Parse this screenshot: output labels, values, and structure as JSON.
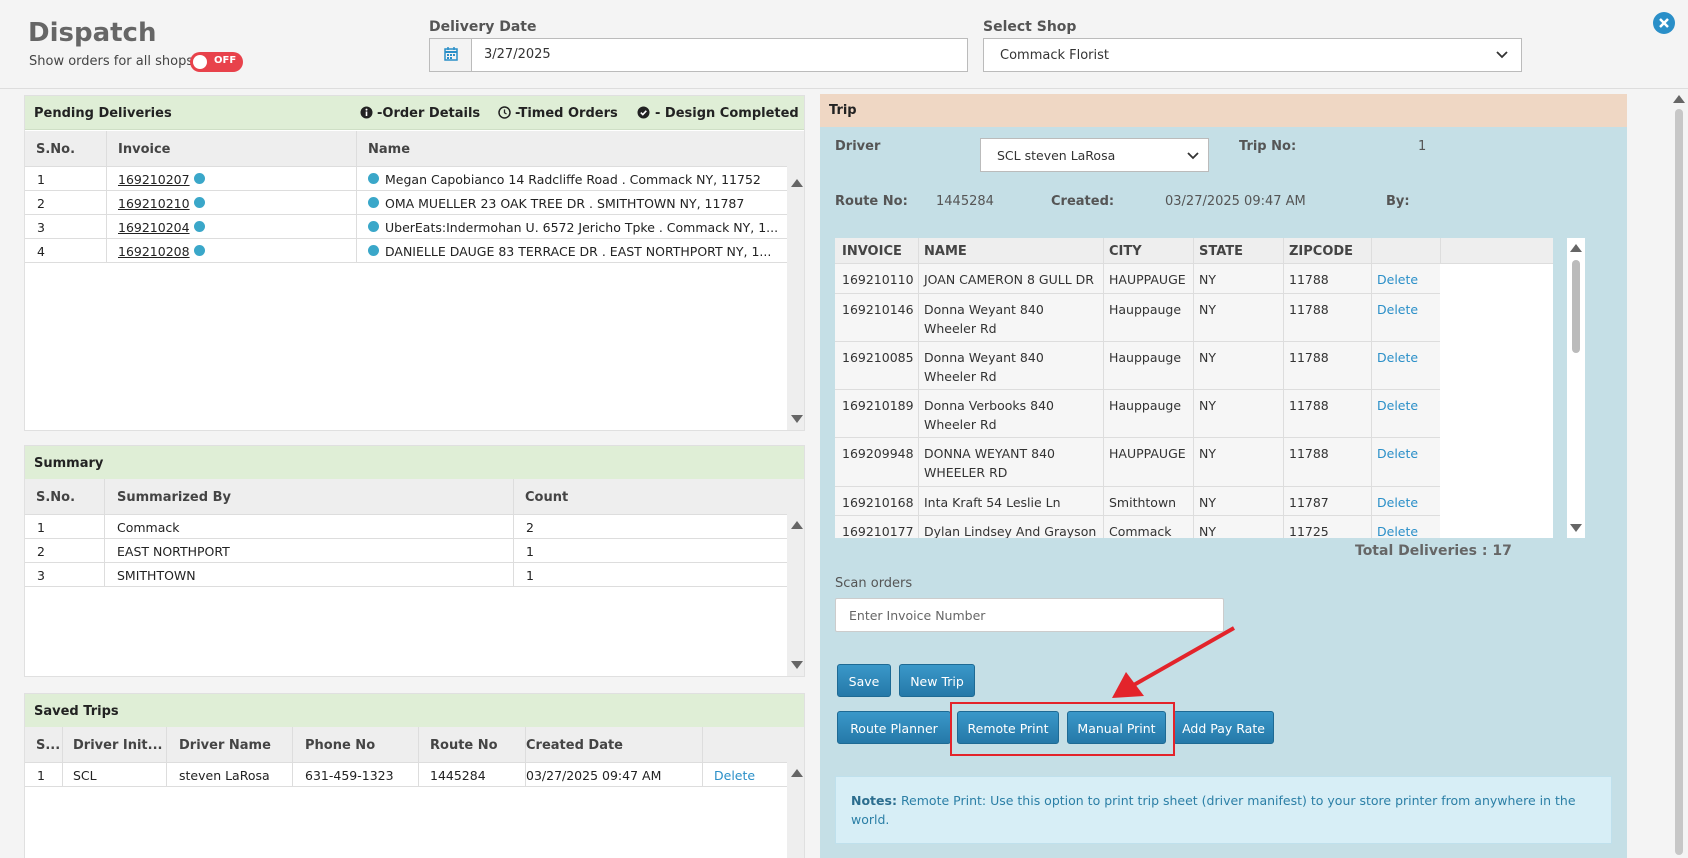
{
  "header": {
    "title": "Dispatch",
    "show_all_label": "Show orders for all shops",
    "toggle_state": "OFF",
    "delivery_date_label": "Delivery Date",
    "delivery_date_value": "3/27/2025",
    "select_shop_label": "Select Shop",
    "select_shop_value": "Commack Florist"
  },
  "pending": {
    "title": "Pending Deliveries",
    "legend_order_details": "-Order Details",
    "legend_timed_orders": "-Timed Orders",
    "legend_design_completed": "- Design Completed",
    "columns": [
      "S.No.",
      "Invoice",
      "Name"
    ],
    "rows": [
      {
        "sno": "1",
        "invoice": "169210207",
        "name": "Megan Capobianco 14 Radcliffe Road . Commack NY, 11752"
      },
      {
        "sno": "2",
        "invoice": "169210210",
        "name": "OMA MUELLER 23 OAK TREE DR . SMITHTOWN NY, 11787"
      },
      {
        "sno": "3",
        "invoice": "169210204",
        "name": "UberEats:Indermohan U. 6572 Jericho Tpke . Commack NY, 1..."
      },
      {
        "sno": "4",
        "invoice": "169210208",
        "name": "DANIELLE DAUGE 83 TERRACE DR . EAST NORTHPORT NY, 1..."
      }
    ]
  },
  "summary": {
    "title": "Summary",
    "columns": [
      "S.No.",
      "Summarized By",
      "Count"
    ],
    "rows": [
      {
        "sno": "1",
        "by": "Commack",
        "count": "2"
      },
      {
        "sno": "2",
        "by": "EAST NORTHPORT",
        "count": "1"
      },
      {
        "sno": "3",
        "by": "SMITHTOWN",
        "count": "1"
      }
    ]
  },
  "saved_trips": {
    "title": "Saved Trips",
    "columns": [
      "S...",
      "Driver Init...",
      "Driver Name",
      "Phone No",
      "Route No",
      "Created Date"
    ],
    "rows": [
      {
        "sno": "1",
        "init": "SCL",
        "driver": "steven LaRosa",
        "phone": "631-459-1323",
        "route": "1445284",
        "created": "03/27/2025 09:47 AM",
        "action": "Delete"
      }
    ]
  },
  "trip": {
    "title": "Trip",
    "driver_label": "Driver",
    "driver_value": "SCL steven LaRosa",
    "trip_no_label": "Trip No:",
    "trip_no_value": "1",
    "route_no_label": "Route No:",
    "route_no_value": "1445284",
    "created_label": "Created:",
    "created_value": "03/27/2025 09:47 AM",
    "by_label": "By:",
    "columns": [
      "INVOICE",
      "NAME",
      "CITY",
      "STATE",
      "ZIPCODE"
    ],
    "rows": [
      {
        "invoice": "169210110",
        "name": "JOAN CAMERON 8 GULL DR",
        "city": "HAUPPAUGE",
        "state": "NY",
        "zip": "11788",
        "action": "Delete"
      },
      {
        "invoice": "169210146",
        "name": "Donna Weyant 840 Wheeler Rd",
        "city": "Hauppauge",
        "state": "NY",
        "zip": "11788",
        "action": "Delete"
      },
      {
        "invoice": "169210085",
        "name": "Donna Weyant 840 Wheeler Rd",
        "city": "Hauppauge",
        "state": "NY",
        "zip": "11788",
        "action": "Delete"
      },
      {
        "invoice": "169210189",
        "name": "Donna Verbooks 840 Wheeler Rd",
        "city": "Hauppauge",
        "state": "NY",
        "zip": "11788",
        "action": "Delete"
      },
      {
        "invoice": "169209948",
        "name": "DONNA WEYANT 840 WHEELER RD",
        "city": "HAUPPAUGE",
        "state": "NY",
        "zip": "11788",
        "action": "Delete"
      },
      {
        "invoice": "169210168",
        "name": "Inta Kraft 54 Leslie Ln",
        "city": "Smithtown",
        "state": "NY",
        "zip": "11787",
        "action": "Delete"
      },
      {
        "invoice": "169210177",
        "name": "Dylan Lindsey And Grayson",
        "city": "Commack",
        "state": "NY",
        "zip": "11725",
        "action": "Delete"
      }
    ],
    "total_deliveries": "Total Deliveries : 17",
    "scan_label": "Scan orders",
    "scan_placeholder": "Enter Invoice Number",
    "buttons": {
      "save": "Save",
      "new_trip": "New Trip",
      "route_planner": "Route Planner",
      "remote_print": "Remote Print",
      "manual_print": "Manual Print",
      "add_pay_rate": "Add Pay Rate"
    },
    "notes_label": "Notes:",
    "notes_text": "Remote Print: Use this option to print trip sheet (driver manifest) to your store printer from anywhere in the world."
  },
  "colors": {
    "accent": "#2a8fc8",
    "panel_header_green": "#dfeed6",
    "trip_header": "#efd7c4",
    "trip_bg": "#c5dfe6",
    "toggle_off": "#e8424b",
    "annotation_red": "#e3242b"
  }
}
